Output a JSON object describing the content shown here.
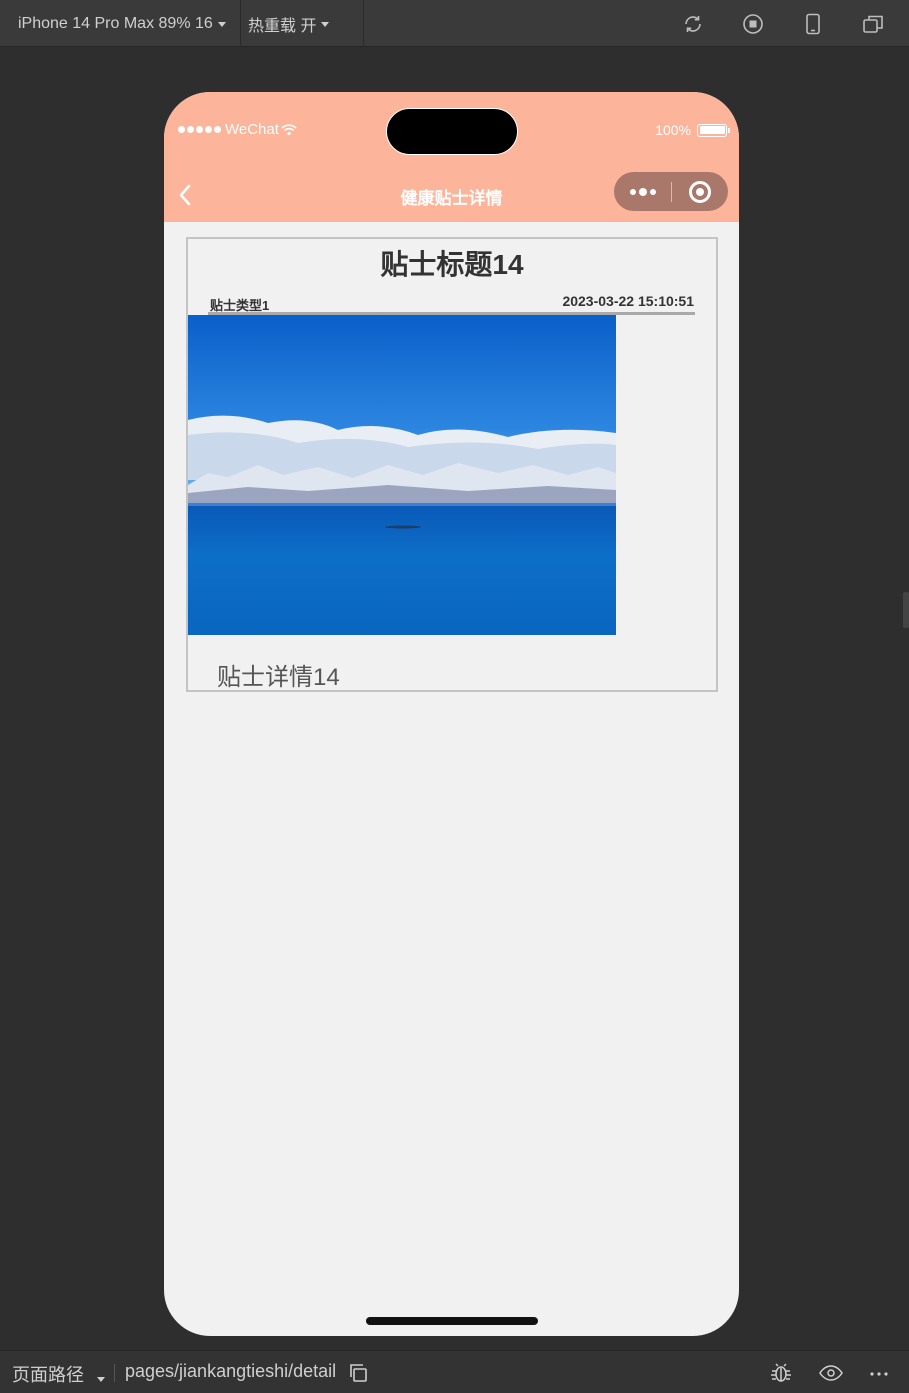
{
  "devtools": {
    "device_label": "iPhone 14 Pro Max 89% 16",
    "hot_reload_label": "热重载 开",
    "path_label": "页面路径",
    "page_path": "pages/jiankangtieshi/detail",
    "icons": [
      "refresh-icon",
      "stop-icon",
      "phone-icon",
      "window-icon",
      "copy-icon",
      "bug-icon",
      "eye-icon",
      "more-icon"
    ]
  },
  "status_bar": {
    "carrier": "WeChat",
    "battery": "100%"
  },
  "nav": {
    "title": "健康贴士详情",
    "background": "#fcb59b",
    "capsule_color": "#a9786a"
  },
  "tip": {
    "title": "贴士标题14",
    "type": "贴士类型1",
    "time": "2023-03-22 15:10:51",
    "detail": "贴士详情14",
    "image_alt": "lake-mountains-image"
  }
}
